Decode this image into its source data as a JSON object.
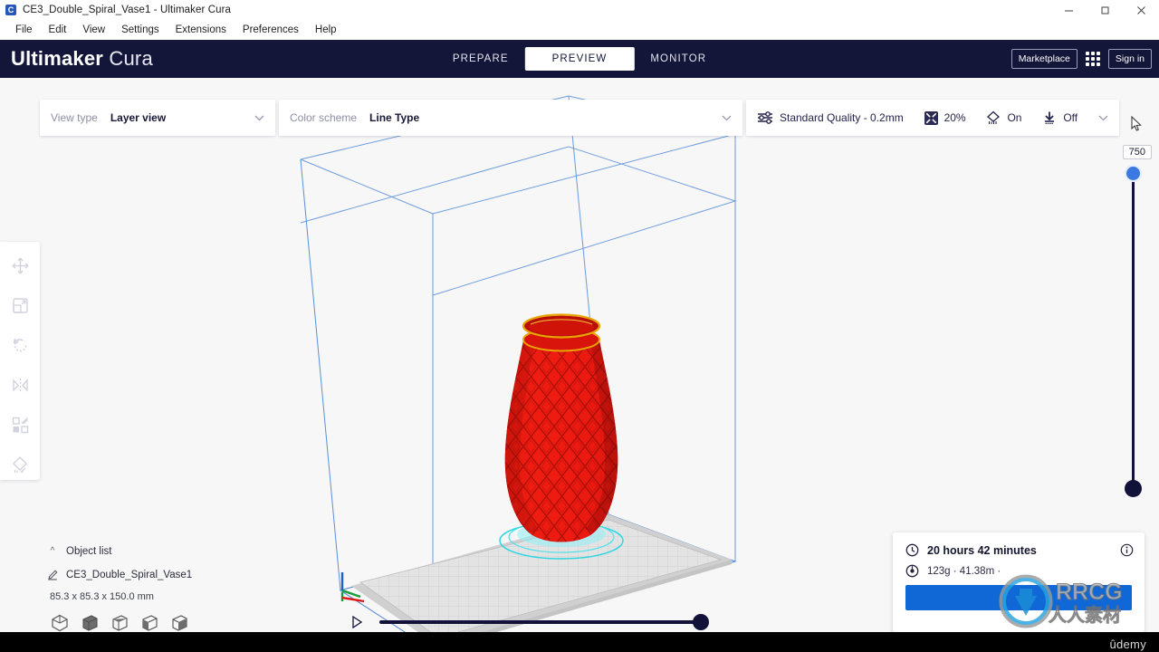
{
  "window": {
    "app_icon": "C",
    "title": "CE3_Double_Spiral_Vase1 - Ultimaker Cura",
    "controls": {
      "minimize": "minimize-icon",
      "maximize": "maximize-icon",
      "close": "close-icon"
    }
  },
  "menubar": {
    "items": [
      {
        "label": "File"
      },
      {
        "label": "Edit"
      },
      {
        "label": "View"
      },
      {
        "label": "Settings"
      },
      {
        "label": "Extensions"
      },
      {
        "label": "Preferences"
      },
      {
        "label": "Help"
      }
    ]
  },
  "header": {
    "brand_bold": "Ultimaker",
    "brand_light": "Cura",
    "stages": [
      {
        "label": "PREPARE",
        "active": false
      },
      {
        "label": "PREVIEW",
        "active": true
      },
      {
        "label": "MONITOR",
        "active": false
      }
    ],
    "marketplace_label": "Marketplace",
    "signin_label": "Sign in",
    "apps_icon": "grid-apps-icon",
    "accent_dark": "#131539"
  },
  "controlbar": {
    "view_type_label": "View type",
    "view_type_value": "Layer view",
    "color_scheme_label": "Color scheme",
    "color_scheme_value": "Line Type",
    "profile_value": "Standard Quality - 0.2mm",
    "infill_value": "20%",
    "support_value": "On",
    "adhesion_value": "Off",
    "profile_icon": "sliders-icon",
    "infill_icon": "infill-icon",
    "support_icon": "support-icon",
    "adhesion_icon": "adhesion-icon",
    "expand_icon": "chevron-down-icon"
  },
  "tools": [
    {
      "name": "move-tool",
      "icon": "move-icon"
    },
    {
      "name": "scale-tool",
      "icon": "scale-icon"
    },
    {
      "name": "rotate-tool",
      "icon": "rotate-icon"
    },
    {
      "name": "mirror-tool",
      "icon": "mirror-icon"
    },
    {
      "name": "per-model-settings-tool",
      "icon": "per-model-settings-icon"
    },
    {
      "name": "support-blocker-tool",
      "icon": "support-blocker-icon"
    }
  ],
  "layer_slider": {
    "value": "750",
    "handle_top_color": "#3a7ae0",
    "handle_bottom_color": "#11113a"
  },
  "playback": {
    "play_icon": "play-icon",
    "position_percent": 100
  },
  "object_list": {
    "caret_icon": "chevron-up-icon",
    "title": "Object list",
    "model_icon": "model-edit-icon",
    "model_name": "CE3_Double_Spiral_Vase1",
    "dimensions": "85.3 x 85.3 x 150.0 mm",
    "view_cubes": [
      {
        "name": "view-cube-iso"
      },
      {
        "name": "view-cube-front"
      },
      {
        "name": "view-cube-top"
      },
      {
        "name": "view-cube-left"
      },
      {
        "name": "view-cube-right"
      }
    ]
  },
  "print_info": {
    "clock_icon": "clock-icon",
    "time": "20 hours 42 minutes",
    "material_icon": "spool-icon",
    "material": "123g · 41.38m ·",
    "info_icon": "info-icon",
    "progress_color": "#1068d6"
  },
  "viewport": {
    "background": "#f7f7f7",
    "buildplate_color": "#d6d6d6",
    "volume_outline": "#5a8fd8",
    "model_color": "#ee1b11",
    "model_top_rim_color": "#e8a400",
    "skirt_color": "#2ad6e0"
  },
  "watermarks": {
    "rrcg_latin": "RRCG",
    "rrcg_cjk": "人人素材",
    "udemy": "ûdemy"
  }
}
